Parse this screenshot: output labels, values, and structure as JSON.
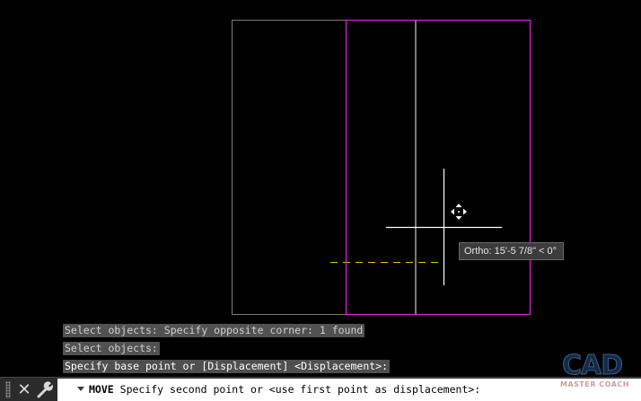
{
  "viewport": {
    "colors": {
      "background": "#000000",
      "original_outline": "#7a7a7a",
      "selected_outline": "#e020e0",
      "rubber_band": "#f0c000",
      "crosshair": "#ffffff"
    }
  },
  "tooltip": {
    "text": "Ortho: 15'-5 7/8\" < 0°"
  },
  "command_history": [
    "Select objects: Specify opposite corner: 1 found",
    "Select objects:",
    "Specify base point or [Displacement] <Displacement>:"
  ],
  "command_line": {
    "close_icon": "close-icon",
    "settings_icon": "wrench-icon",
    "recent_icon": "chevron-down-icon",
    "command_name": "MOVE",
    "prompt": "Specify second point or <use first point as displacement>:"
  },
  "watermark": {
    "big": "CAD",
    "small": "MASTER COACH"
  }
}
